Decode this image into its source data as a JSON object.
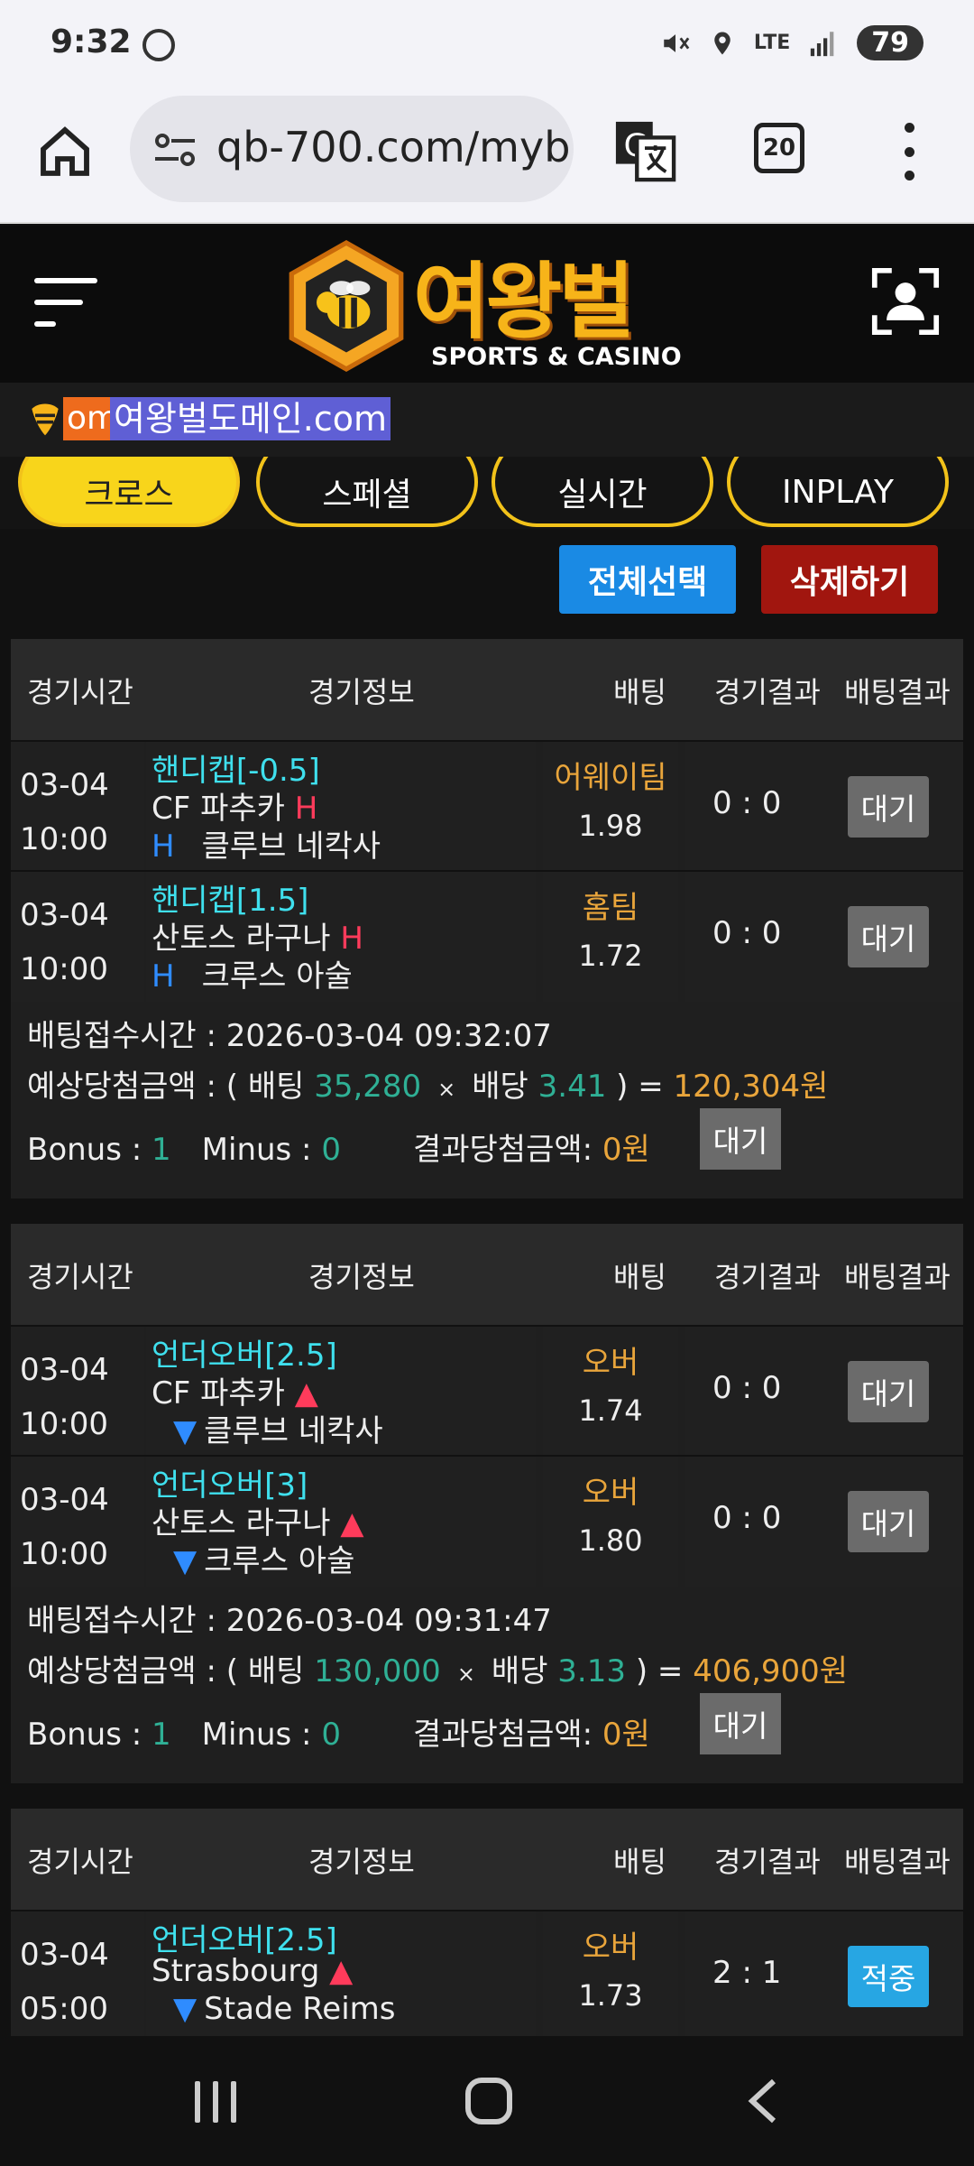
{
  "status_bar": {
    "time": "9:32",
    "network": "LTE",
    "battery": "79"
  },
  "browser": {
    "url": "qb-700.com/myb",
    "tab_count": "20"
  },
  "site": {
    "logo_name": "여왕벌",
    "logo_sub": "SPORTS & CASINO",
    "ticker_prefix": "om",
    "ticker_text": "여왕벌도메인.com"
  },
  "tabs": [
    {
      "label": "크로스",
      "active": true
    },
    {
      "label": "스페셜",
      "active": false
    },
    {
      "label": "실시간",
      "active": false
    },
    {
      "label": "INPLAY",
      "active": false
    }
  ],
  "actions": {
    "select_all": "전체선택",
    "delete": "삭제하기"
  },
  "table_headers": {
    "time": "경기시간",
    "info": "경기정보",
    "bet": "배팅",
    "result": "경기결과",
    "bet_result": "배팅결과"
  },
  "summary_labels": {
    "received": "배팅접수시간 :",
    "expected": "예상당첨금액 : ( 배팅",
    "odds": "배당",
    "equals": ") =",
    "bonus": "Bonus :",
    "minus": "Minus :",
    "won": "결과당첨금액:"
  },
  "slips": [
    {
      "rows": [
        {
          "date": "03-04",
          "time": "10:00",
          "type": "핸디캡[-0.5]",
          "home": "CF 파추카",
          "away": "클루브 네칵사",
          "home_mark": "H",
          "away_mark": "H",
          "mark_style": "handicap",
          "pick": "어웨이팀",
          "odds": "1.98",
          "score": "0 : 0",
          "status": "대기"
        },
        {
          "date": "03-04",
          "time": "10:00",
          "type": "핸디캡[1.5]",
          "home": "산토스 라구나",
          "away": "크루스 아술",
          "home_mark": "H",
          "away_mark": "H",
          "mark_style": "handicap",
          "pick": "홈팀",
          "odds": "1.72",
          "score": "0 : 0",
          "status": "대기"
        }
      ],
      "received_time": "2026-03-04 09:32:07",
      "stake": "35,280",
      "total_odds": "3.41",
      "expected_win": "120,304원",
      "bonus": "1",
      "minus": "0",
      "won_amount": "0원",
      "status": "대기"
    },
    {
      "rows": [
        {
          "date": "03-04",
          "time": "10:00",
          "type": "언더오버[2.5]",
          "home": "CF 파추카",
          "away": "클루브 네칵사",
          "home_mark": "▲",
          "away_mark": "▼",
          "mark_style": "ou",
          "pick": "오버",
          "odds": "1.74",
          "score": "0 : 0",
          "status": "대기"
        },
        {
          "date": "03-04",
          "time": "10:00",
          "type": "언더오버[3]",
          "home": "산토스 라구나",
          "away": "크루스 아술",
          "home_mark": "▲",
          "away_mark": "▼",
          "mark_style": "ou",
          "pick": "오버",
          "odds": "1.80",
          "score": "0 : 0",
          "status": "대기"
        }
      ],
      "received_time": "2026-03-04 09:31:47",
      "stake": "130,000",
      "total_odds": "3.13",
      "expected_win": "406,900원",
      "bonus": "1",
      "minus": "0",
      "won_amount": "0원",
      "status": "대기"
    },
    {
      "rows": [
        {
          "date": "03-04",
          "time": "05:00",
          "type": "언더오버[2.5]",
          "home": "Strasbourg",
          "away": "Stade Reims",
          "home_mark": "▲",
          "away_mark": "▼",
          "mark_style": "ou",
          "pick": "오버",
          "odds": "1.73",
          "score": "2 : 1",
          "status": "적중",
          "win": true
        }
      ]
    }
  ],
  "colors": {
    "accent_yellow": "#f8d51b",
    "select_blue": "#1a8ae4",
    "delete_red": "#a1160f",
    "type_cyan": "#3fe0ee",
    "pick_gold": "#e9a53b",
    "value_teal": "#2fb095",
    "win_blue": "#27a6e3"
  }
}
